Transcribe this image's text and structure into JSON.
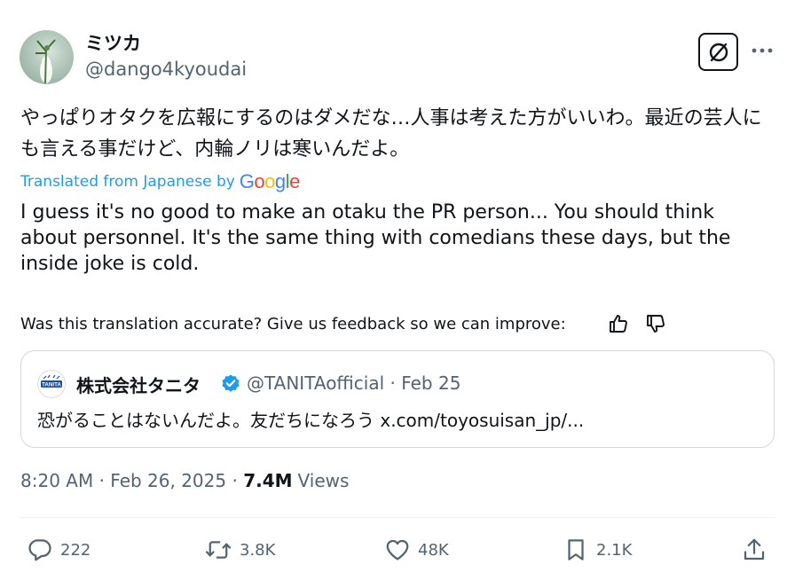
{
  "author": {
    "display_name": "ミツカ",
    "handle": "@dango4kyoudai"
  },
  "tweet": {
    "original_text": "やっぱりオタクを広報にするのはダメだな…人事は考えた方がいいわ。最近の芸人にも言える事だけど、内輪ノリは寒いんだよ。",
    "translated_label": "Translated from Japanese by",
    "translation_text": "I guess it's no good to make an otaku the PR person... You should think about personnel. It's the same thing with comedians these days, but the inside joke is cold.",
    "feedback_prompt": "Was this translation accurate? Give us feedback so we can improve:"
  },
  "google_logo": {
    "letters": [
      "G",
      "o",
      "o",
      "g",
      "l",
      "e"
    ],
    "colors": [
      "#4285f4",
      "#ea4335",
      "#fbbc05",
      "#4285f4",
      "#34a853",
      "#ea4335"
    ]
  },
  "quoted_tweet": {
    "display_name": "株式会社タニタ",
    "handle_and_date": "@TANITAofficial · Feb 25",
    "text": "恐がることはないんだよ。友だちになろう x.com/toyosuisan_jp/...",
    "avatar_logo_text": "TANITA"
  },
  "meta": {
    "time_and_date": "8:20 AM · Feb 26, 2025 · ",
    "views_count": "7.4M",
    "views_label": "Views"
  },
  "actions": {
    "replies": "222",
    "reposts": "3.8K",
    "likes": "48K",
    "bookmarks": "2.1K"
  },
  "colors": {
    "accent": "#1d9bf0",
    "secondary_text": "#536471",
    "verified_badge": "#1d9bf0"
  },
  "icons": [
    "grok-icon",
    "more-icon",
    "thumbs-up-icon",
    "thumbs-down-icon",
    "verified-icon",
    "reply-icon",
    "repost-icon",
    "like-icon",
    "bookmark-icon",
    "share-icon"
  ]
}
